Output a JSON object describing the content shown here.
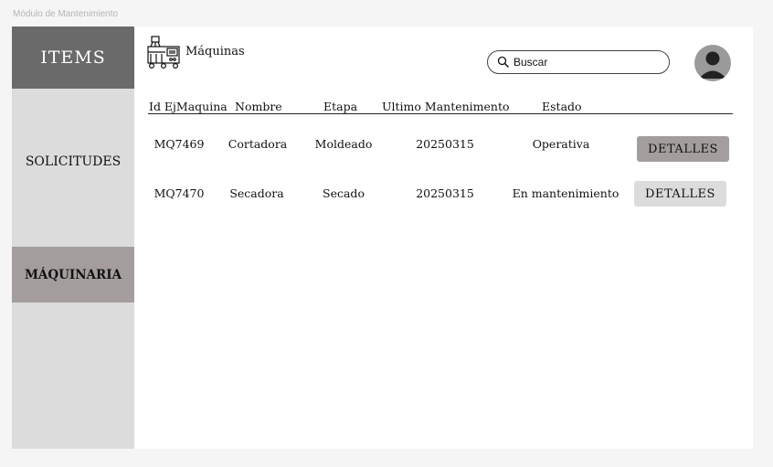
{
  "frame_title": "Módulo de Mantenimiento",
  "sidebar": {
    "header": "ITEMS",
    "items": [
      {
        "label": "SOLICITUDES",
        "active": false
      },
      {
        "label": "MÁQUINARIA",
        "active": true
      }
    ]
  },
  "header": {
    "icon": "machine-icon",
    "title": "Máquinas",
    "search": {
      "placeholder": "Buscar",
      "icon": "search-icon"
    },
    "avatar_icon": "user-icon"
  },
  "table": {
    "columns": [
      "Id EjMaquina",
      "Nombre",
      "Etapa",
      "Ultimo Mantenimento",
      "Estado"
    ],
    "rows": [
      {
        "id": "MQ7469",
        "nombre": "Cortadora",
        "etapa": "Moldeado",
        "ultimo": "20250315",
        "estado": "Operativa",
        "action": "DETALLES"
      },
      {
        "id": "MQ7470",
        "nombre": "Secadora",
        "etapa": "Secado",
        "ultimo": "20250315",
        "estado": "En mantenimiento",
        "action": "DETALLES"
      }
    ]
  },
  "colors": {
    "page_bg": "#f5f5f5",
    "sidebar_bg": "#dcdcdc",
    "sidebar_header_bg": "#6a6a6a",
    "active_item_bg": "#a39e9d",
    "button_dark": "#a39e9d",
    "button_light": "#dcdcdc"
  }
}
